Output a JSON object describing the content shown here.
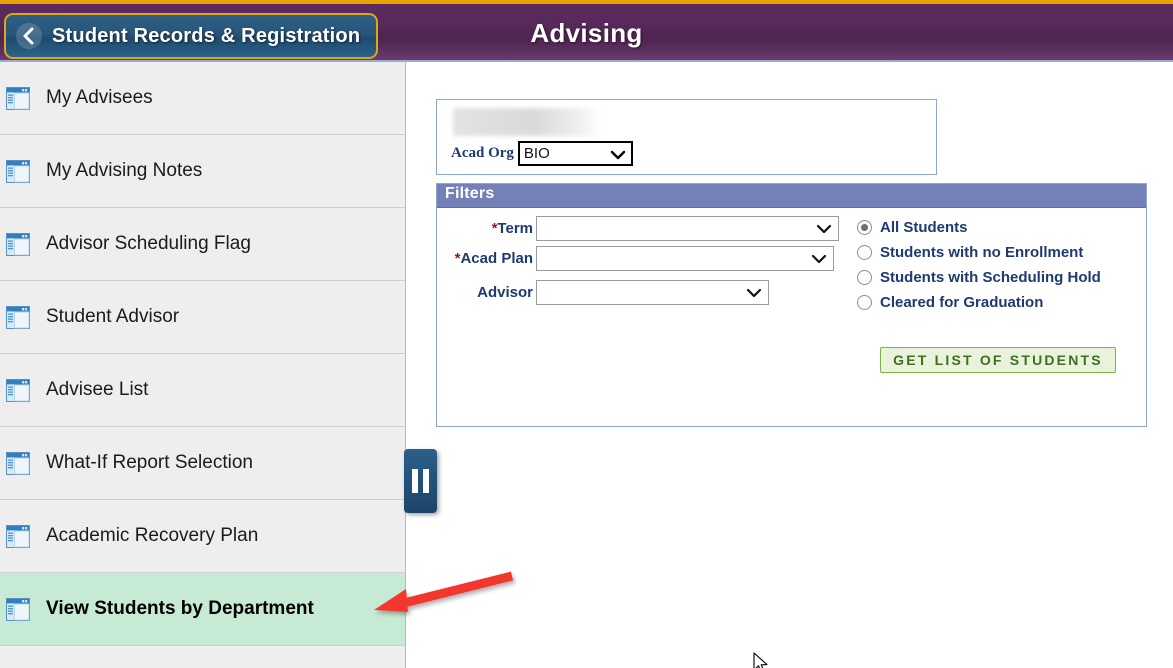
{
  "header": {
    "back_label": "Student Records & Registration",
    "back_icon": "chevron-left-icon",
    "title": "Advising",
    "accent_gold": "#e9a400",
    "bg_purple": "#572959"
  },
  "sidebar": {
    "items": [
      {
        "label": "My Advisees",
        "icon": "window-list-icon",
        "selected": false
      },
      {
        "label": "My Advising Notes",
        "icon": "window-list-icon",
        "selected": false
      },
      {
        "label": "Advisor Scheduling Flag",
        "icon": "window-list-icon",
        "selected": false
      },
      {
        "label": "Student Advisor",
        "icon": "window-list-icon",
        "selected": false
      },
      {
        "label": "Advisee List",
        "icon": "window-list-icon",
        "selected": false
      },
      {
        "label": "What-If Report Selection",
        "icon": "window-list-icon",
        "selected": false
      },
      {
        "label": "Academic Recovery Plan",
        "icon": "window-list-icon",
        "selected": false
      },
      {
        "label": "View Students by Department",
        "icon": "window-list-icon",
        "selected": true
      }
    ],
    "selected_bg": "#c7ead5",
    "collapse_icon": "pause-collapse-icon"
  },
  "main": {
    "acad_org": {
      "label": "Acad Org",
      "value": "BIO",
      "redacted": true
    },
    "filters": {
      "title": "Filters",
      "header_color": "#7481b8",
      "fields": [
        {
          "label": "*Term",
          "required": true,
          "value": "",
          "placeholder": ""
        },
        {
          "label": "*Acad Plan",
          "required": true,
          "value": "",
          "placeholder": ""
        },
        {
          "label": "Advisor",
          "required": false,
          "value": "",
          "placeholder": ""
        }
      ],
      "radio_options": [
        {
          "label": "All Students",
          "selected": true
        },
        {
          "label": "Students with no Enrollment",
          "selected": false
        },
        {
          "label": "Students with Scheduling Hold",
          "selected": false
        },
        {
          "label": "Cleared for Graduation",
          "selected": false
        }
      ],
      "submit_label": "GET LIST OF STUDENTS",
      "submit_color": "#3f7020"
    }
  },
  "annotations": {
    "arrow_color": "#f2382f",
    "arrow_points_to": "View Students by Department"
  }
}
